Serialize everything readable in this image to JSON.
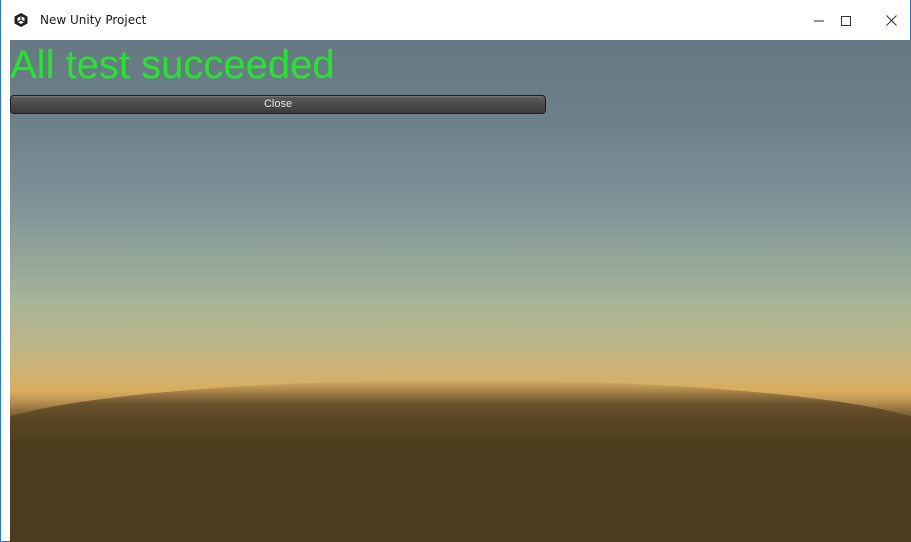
{
  "window": {
    "title": "New Unity Project",
    "app_icon": "unity-logo-icon",
    "controls": {
      "minimize_icon": "minimize-icon",
      "maximize_icon": "maximize-icon",
      "close_icon": "close-icon"
    }
  },
  "game": {
    "status_text": "All test succeeded",
    "status_color": "#22e82a",
    "close_button_label": "Close"
  },
  "colors": {
    "window_border": "#2b78d6",
    "sky_top": "#667882",
    "horizon": "#d9ad5c",
    "ground": "#4c3b1e"
  }
}
